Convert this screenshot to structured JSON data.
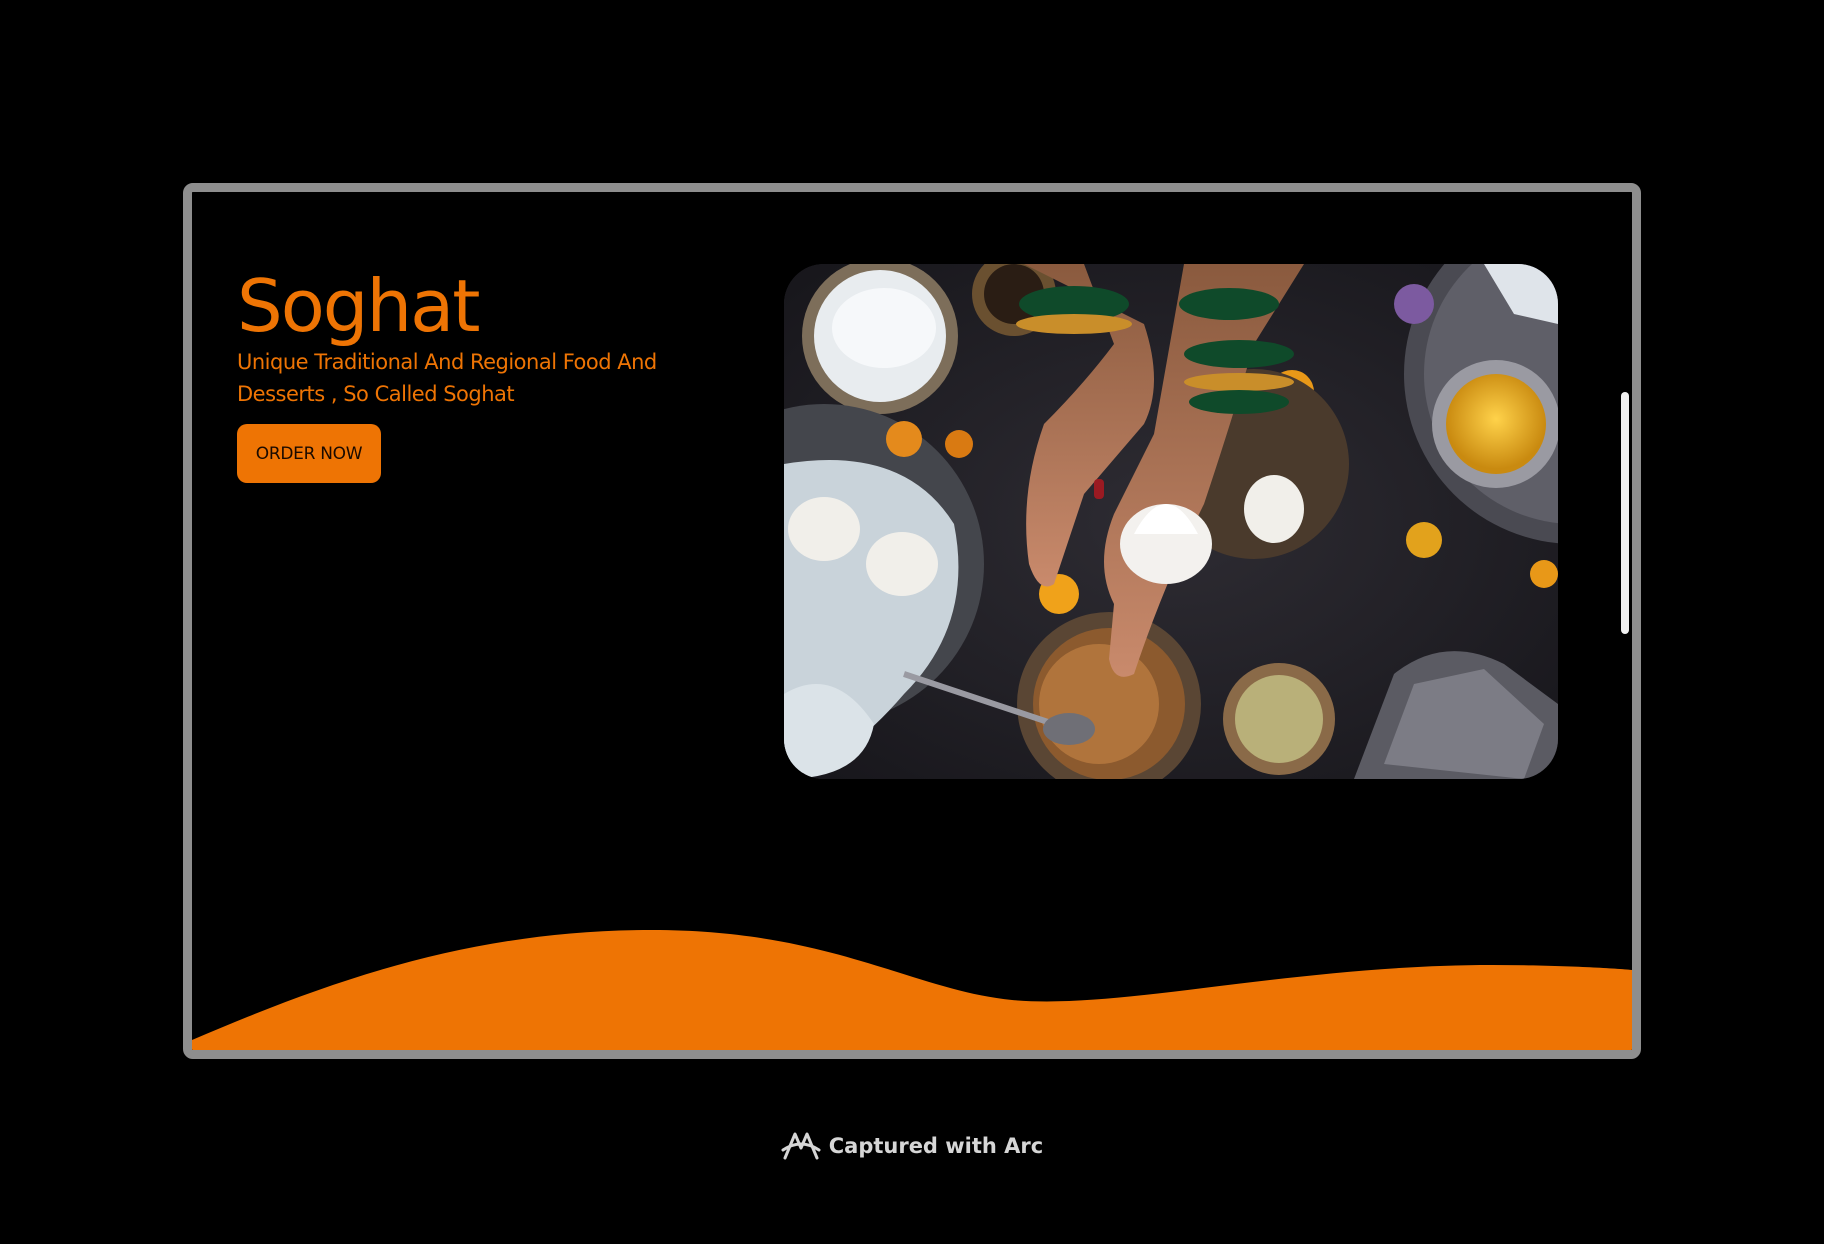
{
  "hero": {
    "title": "Soghat",
    "tagline": "Unique Traditional And Regional Food And Desserts , So Called Soghat",
    "order_button_label": "ORDER NOW",
    "image_alt": "Hands holding a modak above plates of traditional sweets, marigold flowers and bowls"
  },
  "footer": {
    "captured_label": "Captured with Arc"
  },
  "colors": {
    "accent": "#ee7404",
    "background": "#000000",
    "frame": "#8e8e8e"
  },
  "icons": {
    "arc_logo": "arc-logo-icon"
  }
}
